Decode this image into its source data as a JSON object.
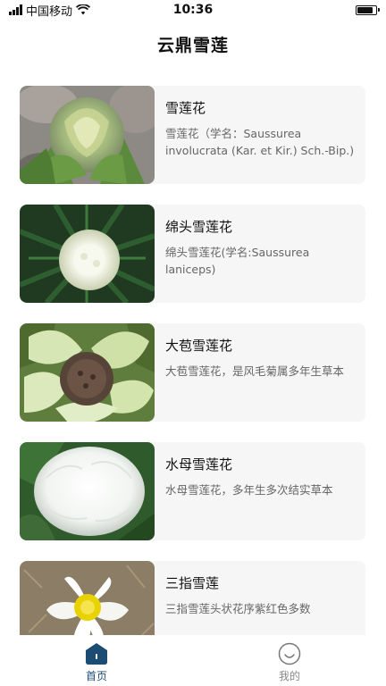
{
  "status_bar": {
    "carrier": "中国移动",
    "time": "10:36"
  },
  "header": {
    "title": "云鼎雪莲"
  },
  "items": [
    {
      "title": "雪莲花",
      "description": "雪莲花（学名：Saussurea involucrata (Kar. et Kir.) Sch.-Bip.)"
    },
    {
      "title": "绵头雪莲花",
      "description": "绵头雪莲花(学名:Saussurea laniceps)"
    },
    {
      "title": "大苞雪莲花",
      "description": "大苞雪莲花，是风毛菊属多年生草本"
    },
    {
      "title": "水母雪莲花",
      "description": "水母雪莲花，多年生多次结实草本"
    },
    {
      "title": "三指雪莲",
      "description": "三指雪莲头状花序紫红色多数"
    }
  ],
  "tabbar": {
    "home_label": "首页",
    "mine_label": "我的"
  },
  "colors": {
    "accent": "#1c4c74",
    "card_bg": "#f6f6f6",
    "inactive": "#888888"
  },
  "icons": {
    "home": "home-icon",
    "mine": "smiley-face-icon"
  }
}
